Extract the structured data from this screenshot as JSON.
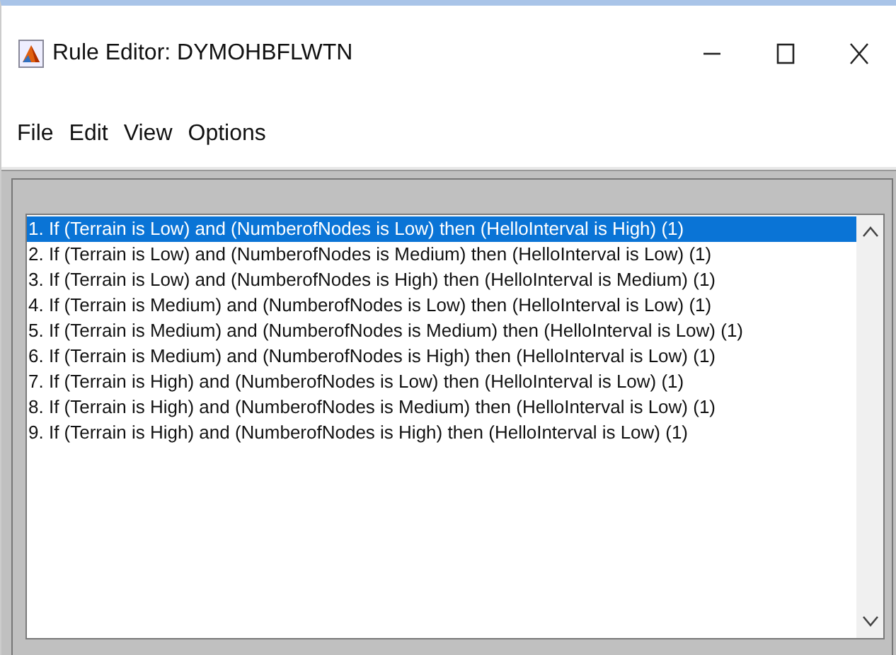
{
  "window": {
    "title": "Rule Editor: DYMOHBFLWTN"
  },
  "menu": [
    "File",
    "Edit",
    "View",
    "Options"
  ],
  "rules": [
    {
      "text": "1. If (Terrain is Low) and (NumberofNodes is Low) then (HelloInterval is High) (1)",
      "selected": true
    },
    {
      "text": "2. If (Terrain is Low) and (NumberofNodes is Medium) then (HelloInterval is Low) (1)",
      "selected": false
    },
    {
      "text": "3. If (Terrain is Low) and (NumberofNodes is High) then (HelloInterval is Medium) (1)",
      "selected": false
    },
    {
      "text": "4. If (Terrain is Medium) and (NumberofNodes is Low) then (HelloInterval is Low) (1)",
      "selected": false
    },
    {
      "text": "5. If (Terrain is Medium) and (NumberofNodes is Medium) then (HelloInterval is Low) (1)",
      "selected": false
    },
    {
      "text": "6. If (Terrain is Medium) and (NumberofNodes is High) then (HelloInterval is Low) (1)",
      "selected": false
    },
    {
      "text": "7. If (Terrain is High) and (NumberofNodes is Low) then (HelloInterval is Low) (1)",
      "selected": false
    },
    {
      "text": "8. If (Terrain is High) and (NumberofNodes is Medium) then (HelloInterval is Low) (1)",
      "selected": false
    },
    {
      "text": "9. If (Terrain is High) and (NumberofNodes is High) then (HelloInterval is Low) (1)",
      "selected": false
    }
  ]
}
